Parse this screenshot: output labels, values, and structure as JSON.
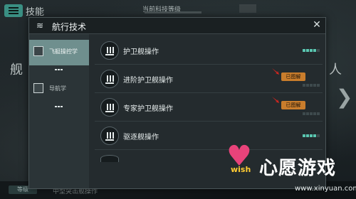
{
  "background": {
    "title": "技能",
    "center_label": "当前科技等级",
    "left_text": "舰",
    "right_text": "人",
    "bottom_left": "等级",
    "bottom_text": "中型突击舰操作",
    "arrow": "❯"
  },
  "dialog": {
    "title": "航行技术",
    "close_icon": "✕",
    "header_icon": "≋"
  },
  "sidebar": {
    "items": [
      {
        "label": "飞艇操控学",
        "active": true
      },
      {
        "label": "导航学",
        "active": false
      }
    ]
  },
  "skills": [
    {
      "label": "护卫舰操作",
      "locked": false,
      "progress": 4,
      "max": 5
    },
    {
      "label": "进阶护卫舰操作",
      "locked": true,
      "lock_label": "已图解",
      "progress": 0,
      "max": 5
    },
    {
      "label": "专家护卫舰操作",
      "locked": true,
      "lock_label": "已图解",
      "progress": 0,
      "max": 5
    },
    {
      "label": "驱逐舰操作",
      "locked": false,
      "progress": 4,
      "max": 5
    }
  ],
  "watermark": {
    "brand": "心愿游戏",
    "wish": "wish",
    "url": "www.xinyuan.com"
  },
  "colors": {
    "accent": "#5ac6b0",
    "lock": "#c97d2c",
    "arrow": "#e0251e",
    "active_side": "#6f8f8e"
  }
}
